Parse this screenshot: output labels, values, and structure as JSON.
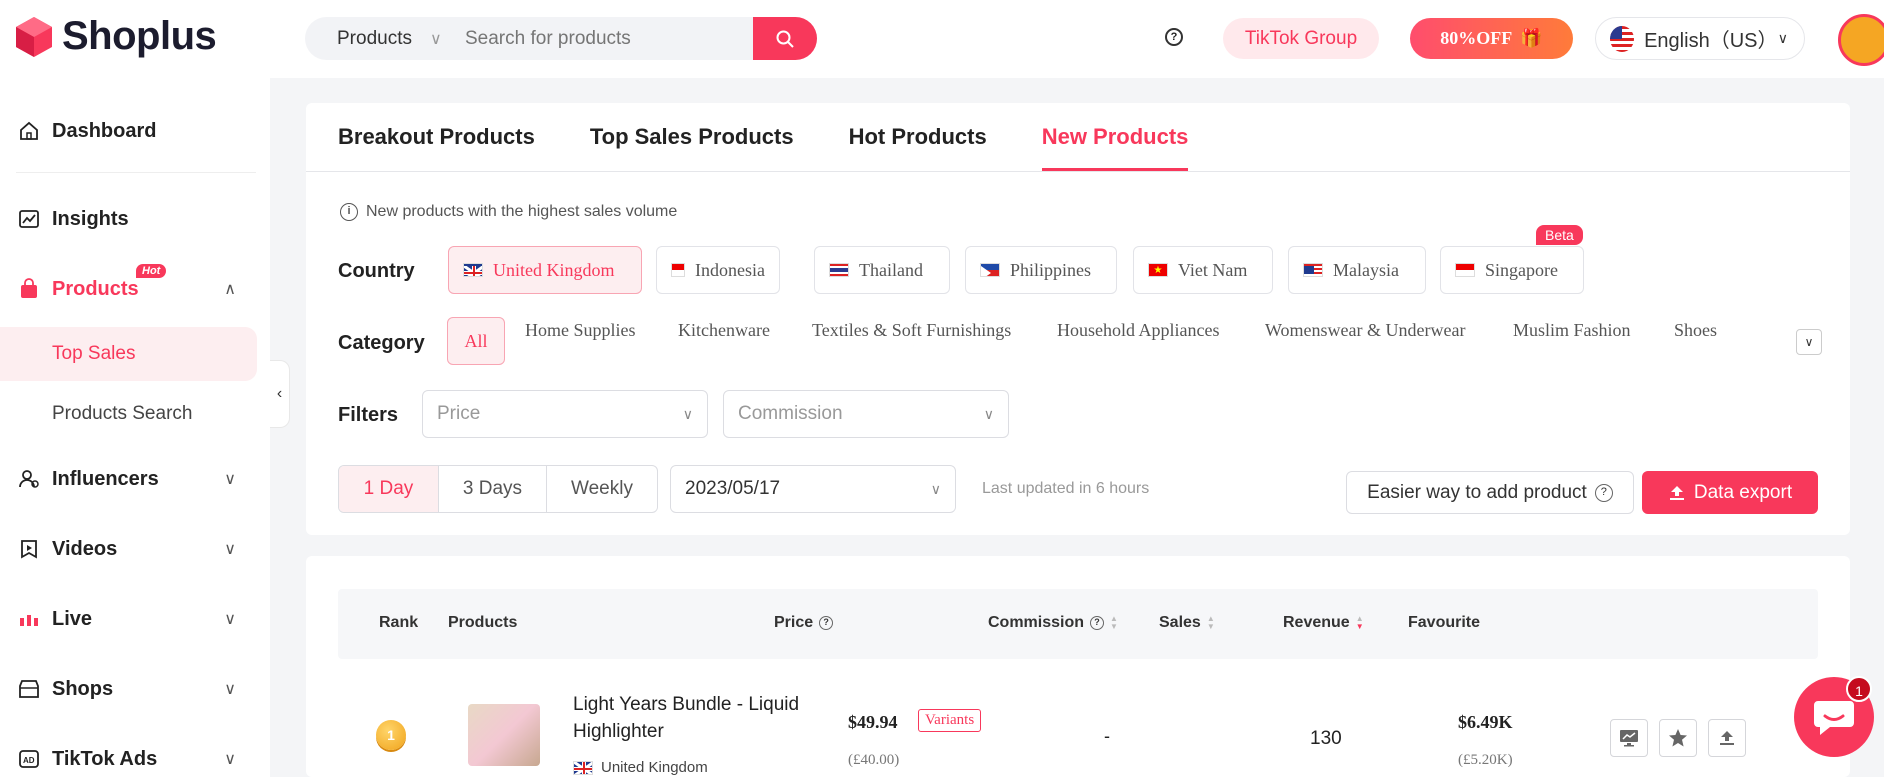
{
  "header": {
    "logo_text": "Shoplus",
    "search_category": "Products",
    "search_placeholder": "Search for products",
    "tiktok_group": "TikTok Group",
    "promo": "80%OFF",
    "language": "English（US）"
  },
  "sidebar": {
    "dashboard": "Dashboard",
    "insights": "Insights",
    "products": "Products",
    "hot_badge": "Hot",
    "top_sales": "Top Sales",
    "products_search": "Products Search",
    "influencers": "Influencers",
    "videos": "Videos",
    "live": "Live",
    "shops": "Shops",
    "tiktok_ads": "TikTok Ads"
  },
  "tabs": [
    "Breakout Products",
    "Top Sales Products",
    "Hot Products",
    "New Products"
  ],
  "active_tab": "New Products",
  "info": "New products with the highest sales volume",
  "labels": {
    "country": "Country",
    "category": "Category",
    "filters": "Filters"
  },
  "countries": [
    "United Kingdom",
    "Indonesia",
    "Thailand",
    "Philippines",
    "Viet Nam",
    "Malaysia",
    "Singapore"
  ],
  "beta": "Beta",
  "categories": [
    "All",
    "Home Supplies",
    "Kitchenware",
    "Textiles & Soft Furnishings",
    "Household Appliances",
    "Womenswear & Underwear",
    "Muslim Fashion",
    "Shoes"
  ],
  "filters": {
    "price": "Price",
    "commission": "Commission"
  },
  "periods": [
    "1 Day",
    "3 Days",
    "Weekly"
  ],
  "date": "2023/05/17",
  "last_updated": "Last updated in 6 hours",
  "easier_btn": "Easier way to add product",
  "export_btn": "Data export",
  "table": {
    "headers": {
      "rank": "Rank",
      "products": "Products",
      "price": "Price",
      "commission": "Commission",
      "sales": "Sales",
      "revenue": "Revenue",
      "favourite": "Favourite"
    },
    "rows": [
      {
        "rank": "1",
        "title": "Light Years Bundle - Liquid Highlighter",
        "country": "United Kingdom",
        "price": "$49.94",
        "variants": "Variants",
        "price_local": "(£40.00)",
        "commission": "-",
        "sales": "130",
        "revenue": "$6.49K",
        "revenue_local": "(£5.20K)"
      }
    ]
  },
  "chat_badge": "1",
  "colors": {
    "accent": "#f8385b"
  }
}
